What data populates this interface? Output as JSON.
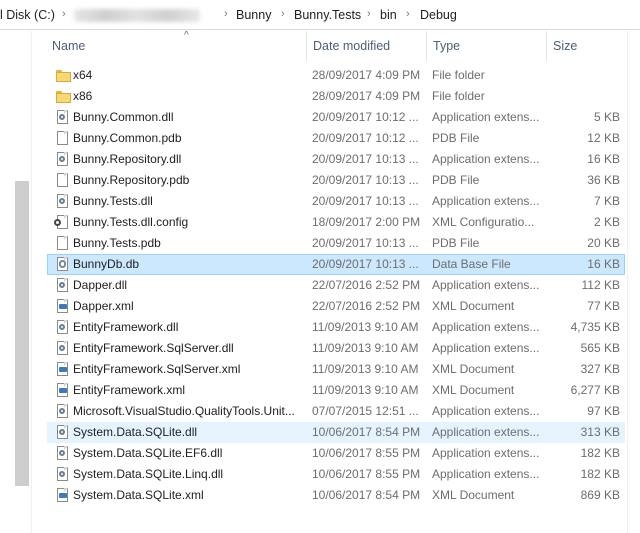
{
  "breadcrumb": {
    "drive": "l Disk (C:)",
    "blurred": "development-code-school",
    "items": [
      "Bunny",
      "Bunny.Tests",
      "bin",
      "Debug"
    ]
  },
  "columns": {
    "name": "Name",
    "date": "Date modified",
    "type": "Type",
    "size": "Size"
  },
  "files": [
    {
      "name": "x64",
      "date": "28/09/2017 4:09 PM",
      "type": "File folder",
      "size": "",
      "icon": "folder-icon"
    },
    {
      "name": "x86",
      "date": "28/09/2017 4:09 PM",
      "type": "File folder",
      "size": "",
      "icon": "folder-icon"
    },
    {
      "name": "Bunny.Common.dll",
      "date": "20/09/2017 10:12 ...",
      "type": "Application extens...",
      "size": "5 KB",
      "icon": "dll-icon"
    },
    {
      "name": "Bunny.Common.pdb",
      "date": "20/09/2017 10:12 ...",
      "type": "PDB File",
      "size": "12 KB",
      "icon": "file-icon"
    },
    {
      "name": "Bunny.Repository.dll",
      "date": "20/09/2017 10:13 ...",
      "type": "Application extens...",
      "size": "16 KB",
      "icon": "dll-icon"
    },
    {
      "name": "Bunny.Repository.pdb",
      "date": "20/09/2017 10:13 ...",
      "type": "PDB File",
      "size": "36 KB",
      "icon": "file-icon"
    },
    {
      "name": "Bunny.Tests.dll",
      "date": "20/09/2017 10:13 ...",
      "type": "Application extens...",
      "size": "7 KB",
      "icon": "dll-icon"
    },
    {
      "name": "Bunny.Tests.dll.config",
      "date": "18/09/2017 2:00 PM",
      "type": "XML Configuratio...",
      "size": "2 KB",
      "icon": "config-icon"
    },
    {
      "name": "Bunny.Tests.pdb",
      "date": "20/09/2017 10:13 ...",
      "type": "PDB File",
      "size": "20 KB",
      "icon": "file-icon"
    },
    {
      "name": "BunnyDb.db",
      "date": "20/09/2017 10:13 ...",
      "type": "Data Base File",
      "size": "16 KB",
      "icon": "database-icon"
    },
    {
      "name": "Dapper.dll",
      "date": "22/07/2016 2:52 PM",
      "type": "Application extens...",
      "size": "112 KB",
      "icon": "dll-icon"
    },
    {
      "name": "Dapper.xml",
      "date": "22/07/2016 2:52 PM",
      "type": "XML Document",
      "size": "77 KB",
      "icon": "xml-icon"
    },
    {
      "name": "EntityFramework.dll",
      "date": "11/09/2013 9:10 AM",
      "type": "Application extens...",
      "size": "4,735 KB",
      "icon": "dll-icon"
    },
    {
      "name": "EntityFramework.SqlServer.dll",
      "date": "11/09/2013 9:10 AM",
      "type": "Application extens...",
      "size": "565 KB",
      "icon": "dll-icon"
    },
    {
      "name": "EntityFramework.SqlServer.xml",
      "date": "11/09/2013 9:10 AM",
      "type": "XML Document",
      "size": "327 KB",
      "icon": "xml-icon"
    },
    {
      "name": "EntityFramework.xml",
      "date": "11/09/2013 9:10 AM",
      "type": "XML Document",
      "size": "6,277 KB",
      "icon": "xml-icon"
    },
    {
      "name": "Microsoft.VisualStudio.QualityTools.Unit...",
      "date": "07/07/2015 12:51 ...",
      "type": "Application extens...",
      "size": "97 KB",
      "icon": "dll-icon"
    },
    {
      "name": "System.Data.SQLite.dll",
      "date": "10/06/2017 8:54 PM",
      "type": "Application extens...",
      "size": "313 KB",
      "icon": "dll-icon"
    },
    {
      "name": "System.Data.SQLite.EF6.dll",
      "date": "10/06/2017 8:55 PM",
      "type": "Application extens...",
      "size": "182 KB",
      "icon": "dll-icon"
    },
    {
      "name": "System.Data.SQLite.Linq.dll",
      "date": "10/06/2017 8:55 PM",
      "type": "Application extens...",
      "size": "182 KB",
      "icon": "dll-icon"
    },
    {
      "name": "System.Data.SQLite.xml",
      "date": "10/06/2017 8:54 PM",
      "type": "XML Document",
      "size": "869 KB",
      "icon": "xml-icon"
    }
  ],
  "selected_row": "BunnyDb.db",
  "hover_row": "System.Data.SQLite.dll",
  "colors": {
    "selected_bg": "#cce8ff",
    "selected_border": "#99d1ff",
    "hover_bg": "#e5f3ff",
    "header_text": "#4c607a"
  }
}
